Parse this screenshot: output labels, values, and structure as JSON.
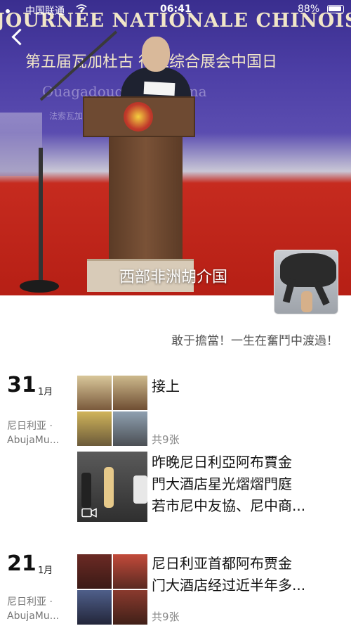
{
  "status_bar": {
    "carrier": "中国联通",
    "time": "06:41",
    "battery": "88%"
  },
  "cover": {
    "banner_line_1": "JOURNÉE NATIONALE CHINOISE D",
    "banner_line_2": "第五届瓦加杜古 行业综合展会中国日",
    "banner_line_3": "Ouagadougou, Burkina",
    "banner_line_4": "法索瓦加杜古国际展览中",
    "name": "西部非洲胡介国"
  },
  "profile": {
    "signature": "敢于擔當！一生在奮鬥中渡過！"
  },
  "posts": [
    {
      "day": "31",
      "month": "1月",
      "location": "尼日利亚 · AbujaMu...",
      "entries": [
        {
          "kind": "photos",
          "text": "接上",
          "count": "共9张"
        },
        {
          "kind": "video",
          "lines": [
            "昨晚尼日利亞阿布賈金",
            "門大酒店星光熠熠門庭",
            "若市尼中友協、尼中商..."
          ]
        }
      ]
    },
    {
      "day": "21",
      "month": "1月",
      "location": "尼日利亚 · AbujaMu...",
      "entries": [
        {
          "kind": "photos",
          "lines": [
            "尼日利亚首都阿布贾金",
            "门大酒店经过近半年多..."
          ],
          "count": "共9张"
        }
      ]
    }
  ]
}
